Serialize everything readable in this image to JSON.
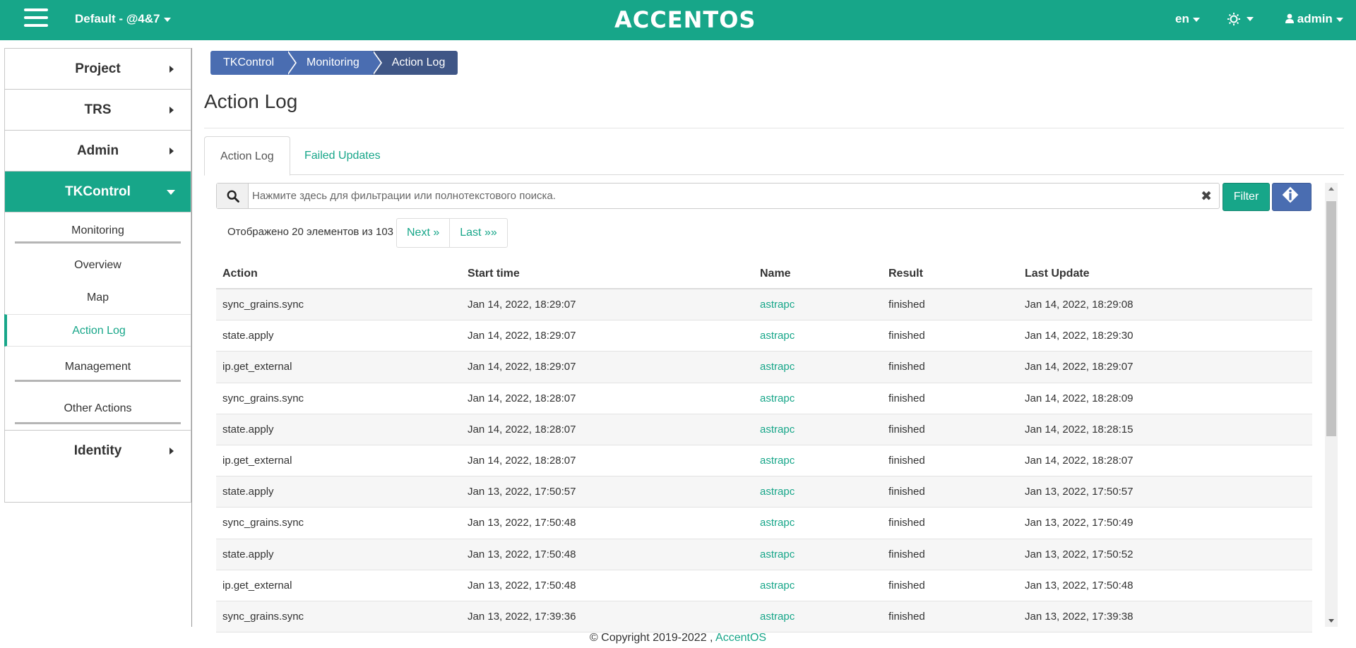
{
  "header": {
    "project_selector": "Default - @4&7",
    "logo_text": "ACCENTOS",
    "language": "en",
    "user": "admin"
  },
  "sidebar": {
    "sections": [
      {
        "label": "Project"
      },
      {
        "label": "TRS"
      },
      {
        "label": "Admin"
      },
      {
        "label": "TKControl"
      },
      {
        "label": "Identity"
      }
    ],
    "tkcontrol": {
      "monitoring_group": "Monitoring",
      "items": [
        "Overview",
        "Map",
        "Action Log"
      ],
      "management_group": "Management",
      "other_group": "Other Actions"
    }
  },
  "breadcrumb": [
    "TKControl",
    "Monitoring",
    "Action Log"
  ],
  "page_title": "Action Log",
  "tabs": [
    "Action Log",
    "Failed Updates"
  ],
  "search": {
    "placeholder": "Нажмите здесь для фильтрации или полнотекстового поиска.",
    "filter_label": "Filter"
  },
  "pagination": {
    "summary": "Отображено 20 элементов из 103",
    "next": "Next »",
    "last": "Last »»"
  },
  "table": {
    "columns": [
      "Action",
      "Start time",
      "Name",
      "Result",
      "Last Update"
    ],
    "rows": [
      [
        "sync_grains.sync",
        "Jan 14, 2022, 18:29:07",
        "astrapc",
        "finished",
        "Jan 14, 2022, 18:29:08"
      ],
      [
        "state.apply",
        "Jan 14, 2022, 18:29:07",
        "astrapc",
        "finished",
        "Jan 14, 2022, 18:29:30"
      ],
      [
        "ip.get_external",
        "Jan 14, 2022, 18:29:07",
        "astrapc",
        "finished",
        "Jan 14, 2022, 18:29:07"
      ],
      [
        "sync_grains.sync",
        "Jan 14, 2022, 18:28:07",
        "astrapc",
        "finished",
        "Jan 14, 2022, 18:28:09"
      ],
      [
        "state.apply",
        "Jan 14, 2022, 18:28:07",
        "astrapc",
        "finished",
        "Jan 14, 2022, 18:28:15"
      ],
      [
        "ip.get_external",
        "Jan 14, 2022, 18:28:07",
        "astrapc",
        "finished",
        "Jan 14, 2022, 18:28:07"
      ],
      [
        "state.apply",
        "Jan 13, 2022, 17:50:57",
        "astrapc",
        "finished",
        "Jan 13, 2022, 17:50:57"
      ],
      [
        "sync_grains.sync",
        "Jan 13, 2022, 17:50:48",
        "astrapc",
        "finished",
        "Jan 13, 2022, 17:50:49"
      ],
      [
        "state.apply",
        "Jan 13, 2022, 17:50:48",
        "astrapc",
        "finished",
        "Jan 13, 2022, 17:50:52"
      ],
      [
        "ip.get_external",
        "Jan 13, 2022, 17:50:48",
        "astrapc",
        "finished",
        "Jan 13, 2022, 17:50:48"
      ],
      [
        "sync_grains.sync",
        "Jan 13, 2022, 17:39:36",
        "astrapc",
        "finished",
        "Jan 13, 2022, 17:39:38"
      ]
    ]
  },
  "footer": {
    "copyright": "© Copyright 2019-2022 ,",
    "link": "AccentOS"
  },
  "colors": {
    "brand": "#17a689",
    "breadcrumb": "#4a6db1",
    "breadcrumb_active": "#3f5686"
  }
}
